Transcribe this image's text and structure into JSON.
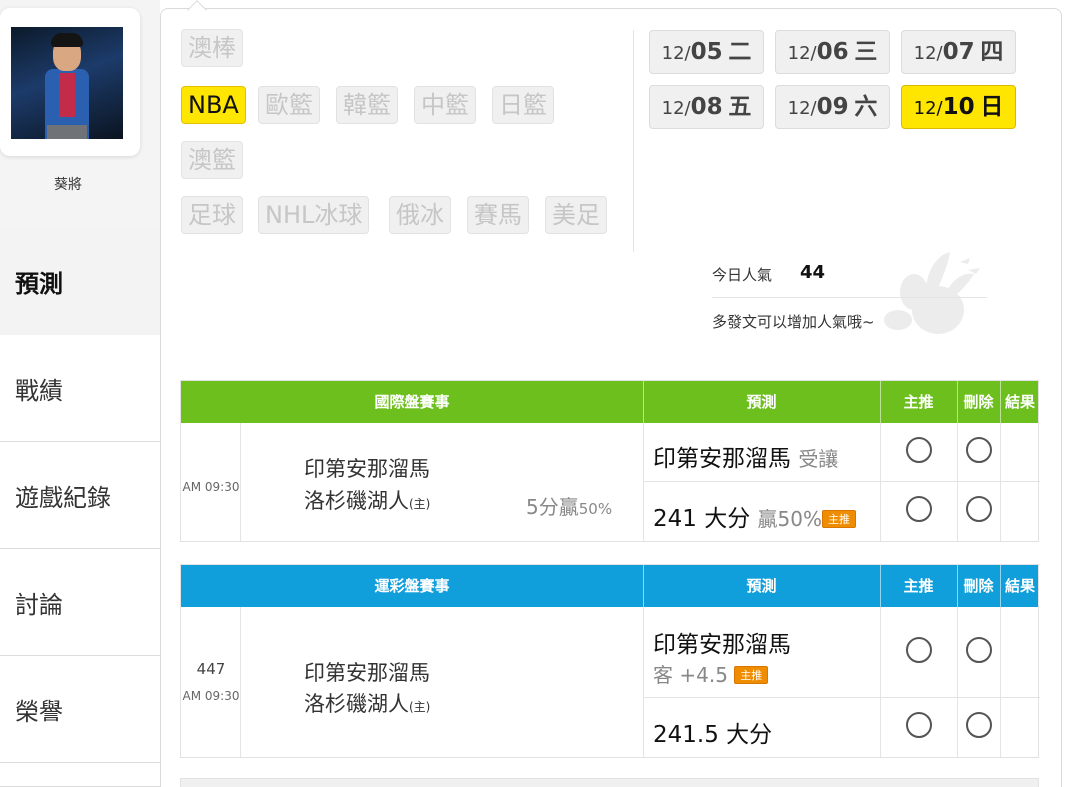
{
  "user": {
    "name": "葵將"
  },
  "nav": {
    "predict": "預測",
    "record": "戰績",
    "game_record": "遊戲紀錄",
    "discuss": "討論",
    "honor": "榮譽"
  },
  "sports": {
    "aus_baseball": "澳棒",
    "nba": "NBA",
    "euro_bball": "歐籃",
    "kor_bball": "韓籃",
    "cn_bball": "中籃",
    "jp_bball": "日籃",
    "aus_bball": "澳籃",
    "soccer": "足球",
    "nhl": "NHL冰球",
    "rus_hockey": "俄冰",
    "horse": "賽馬",
    "nfl": "美足",
    "active": "NBA"
  },
  "dates": [
    {
      "md": "12/",
      "day": "05",
      "wd": "二"
    },
    {
      "md": "12/",
      "day": "06",
      "wd": "三"
    },
    {
      "md": "12/",
      "day": "07",
      "wd": "四"
    },
    {
      "md": "12/",
      "day": "08",
      "wd": "五"
    },
    {
      "md": "12/",
      "day": "09",
      "wd": "六"
    },
    {
      "md": "12/",
      "day": "10",
      "wd": "日",
      "active": true
    }
  ],
  "popularity": {
    "label": "今日人氣",
    "value": "44",
    "tip": "多發文可以增加人氣哦~"
  },
  "intl_table": {
    "headers": {
      "event": "國際盤賽事",
      "predict": "預測",
      "main": "主推",
      "delete": "刪除",
      "result": "結果"
    },
    "game": {
      "time": "AM 09:30",
      "away": "印第安那溜馬",
      "home": "洛杉磯湖人",
      "home_mark": "(主)",
      "spread_text": "5分贏",
      "spread_pct": "50%",
      "pick1": "印第安那溜馬",
      "pick1_note": "受讓",
      "pick2": "241 大分",
      "pick2_note": "贏50%",
      "badge": "主推"
    }
  },
  "sports_lottery_table": {
    "headers": {
      "event": "運彩盤賽事",
      "predict": "預測",
      "main": "主推",
      "delete": "刪除",
      "result": "結果"
    },
    "game": {
      "number": "447",
      "time": "AM 09:30",
      "away": "印第安那溜馬",
      "home": "洛杉磯湖人",
      "home_mark": "(主)",
      "pick1": "印第安那溜馬",
      "pick1_note": "客 +4.5",
      "pick2": "241.5 大分",
      "badge": "主推"
    }
  },
  "colors": {
    "intl_header": "#6cbf1c",
    "lottery_header": "#119fdc",
    "active_button": "#ffe600",
    "badge": "#f08c00"
  }
}
